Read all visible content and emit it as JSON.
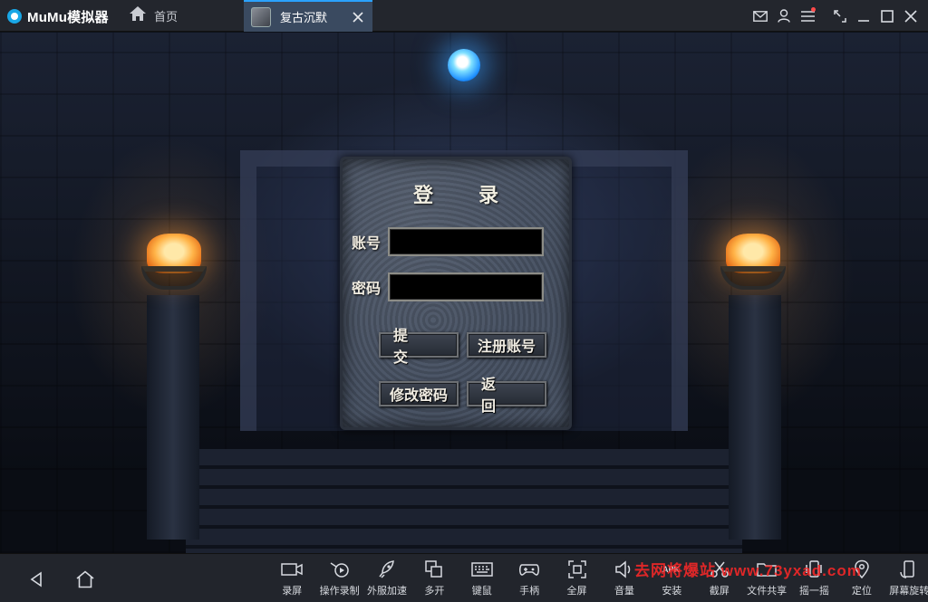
{
  "app": {
    "name": "MuMu模拟器"
  },
  "tabs": [
    {
      "label": "首页"
    },
    {
      "label": "复古沉默"
    }
  ],
  "login": {
    "title": "登 录",
    "account_label": "账号",
    "password_label": "密码",
    "account_value": "",
    "password_value": "",
    "submit_label": "提 交",
    "register_label": "注册账号",
    "change_password_label": "修改密码",
    "back_label": "返 回"
  },
  "toolbar": {
    "items": [
      {
        "label": "录屏",
        "icon": "video-icon"
      },
      {
        "label": "操作录制",
        "icon": "macro-record-icon"
      },
      {
        "label": "外服加速",
        "icon": "rocket-icon"
      },
      {
        "label": "多开",
        "icon": "multi-instance-icon"
      },
      {
        "label": "键鼠",
        "icon": "keyboard-icon"
      },
      {
        "label": "手柄",
        "icon": "gamepad-icon"
      },
      {
        "label": "全屏",
        "icon": "fullscreen-icon"
      },
      {
        "label": "音量",
        "icon": "volume-icon"
      },
      {
        "label": "安装",
        "icon": "apk-icon"
      },
      {
        "label": "截屏",
        "icon": "scissors-icon"
      },
      {
        "label": "文件共享",
        "icon": "folder-icon"
      },
      {
        "label": "摇一摇",
        "icon": "shake-icon"
      },
      {
        "label": "定位",
        "icon": "location-icon"
      },
      {
        "label": "屏幕旋转",
        "icon": "rotate-icon"
      }
    ]
  },
  "watermark": "去网将爆站 www.73yxad.com"
}
